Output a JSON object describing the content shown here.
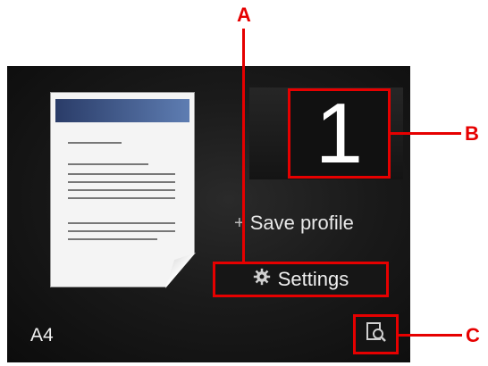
{
  "screen": {
    "copies": "1",
    "save_profile_label": "Save profile",
    "settings_label": "Settings",
    "paper_size": "A4"
  },
  "icons": {
    "settings": "gear-icon",
    "save_profile": "plus-icon",
    "preview": "preview-magnifier-icon"
  },
  "callouts": {
    "a": "A",
    "b": "B",
    "c": "C"
  },
  "colors": {
    "callout": "#e60000",
    "screen_bg": "#141414"
  }
}
